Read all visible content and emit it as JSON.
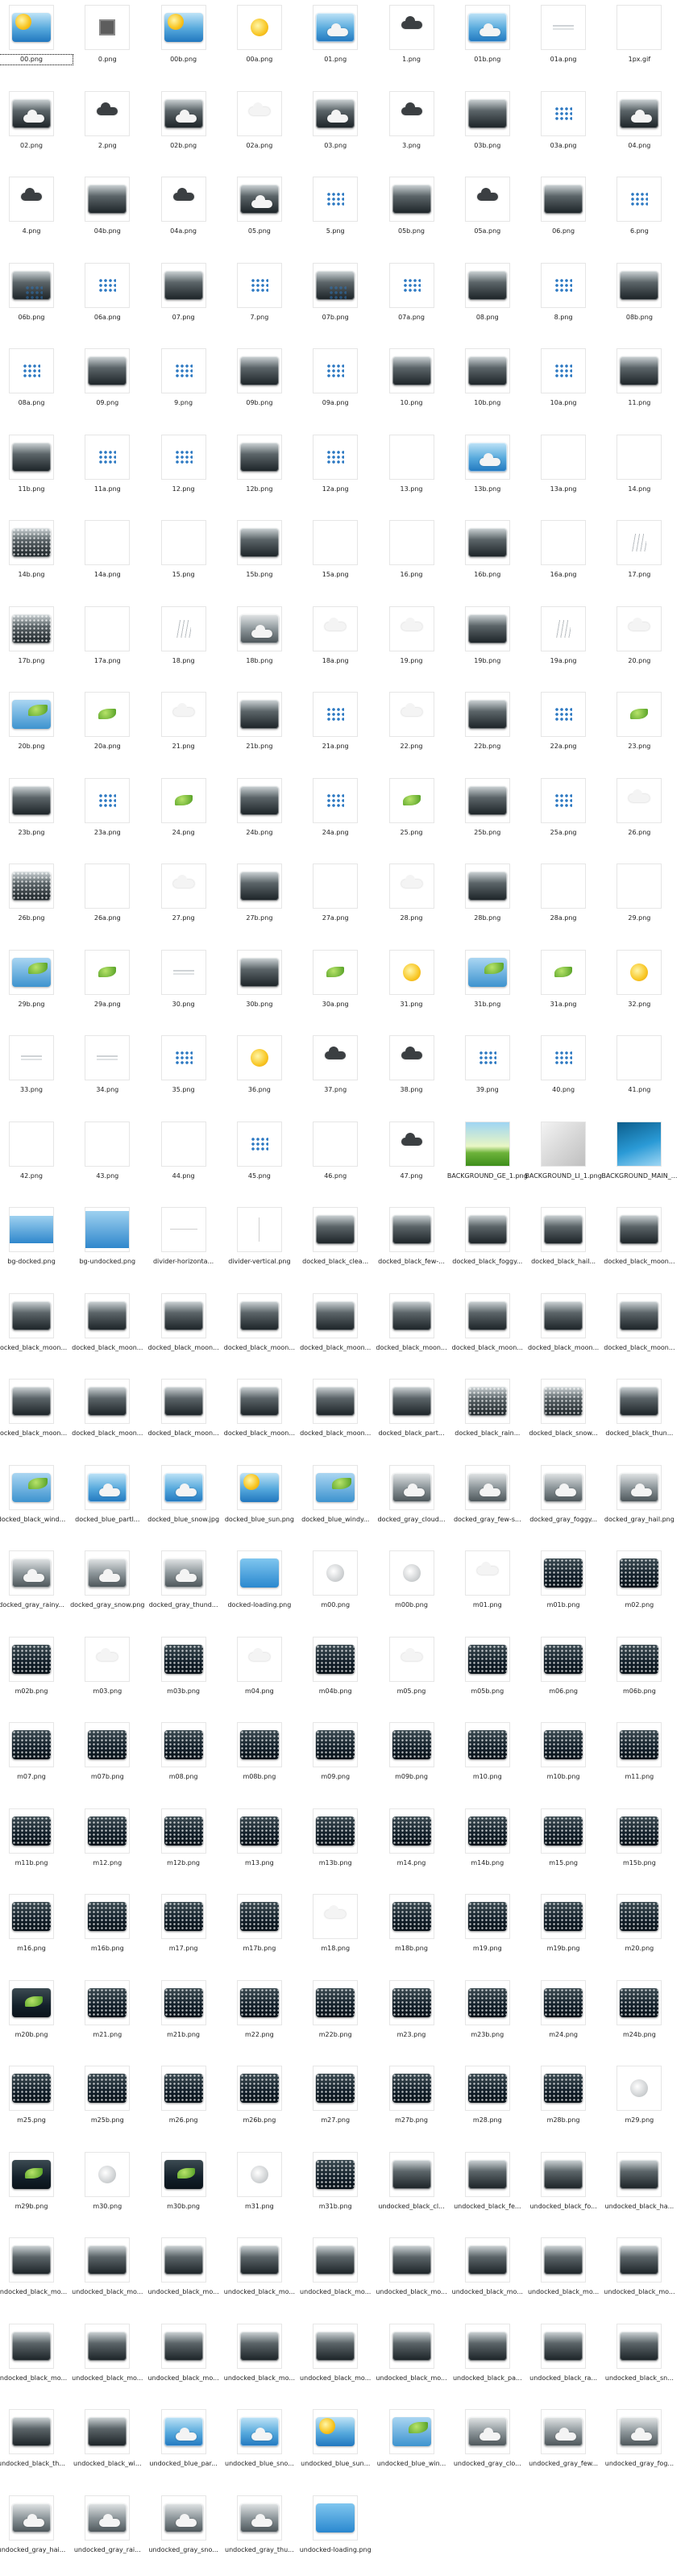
{
  "files": [
    "00.png",
    "0.png",
    "00b.png",
    "00a.png",
    "01.png",
    "1.png",
    "01b.png",
    "01a.png",
    "1px.gif",
    "02.png",
    "2.png",
    "02b.png",
    "02a.png",
    "03.png",
    "3.png",
    "03b.png",
    "03a.png",
    "04.png",
    "4.png",
    "04b.png",
    "04a.png",
    "05.png",
    "5.png",
    "05b.png",
    "05a.png",
    "06.png",
    "6.png",
    "06b.png",
    "06a.png",
    "07.png",
    "7.png",
    "07b.png",
    "07a.png",
    "08.png",
    "8.png",
    "08b.png",
    "08a.png",
    "09.png",
    "9.png",
    "09b.png",
    "09a.png",
    "10.png",
    "10b.png",
    "10a.png",
    "11.png",
    "11b.png",
    "11a.png",
    "12.png",
    "12b.png",
    "12a.png",
    "13.png",
    "13b.png",
    "13a.png",
    "14.png",
    "14b.png",
    "14a.png",
    "15.png",
    "15b.png",
    "15a.png",
    "16.png",
    "16b.png",
    "16a.png",
    "17.png",
    "17b.png",
    "17a.png",
    "18.png",
    "18b.png",
    "18a.png",
    "19.png",
    "19b.png",
    "19a.png",
    "20.png",
    "20b.png",
    "20a.png",
    "21.png",
    "21b.png",
    "21a.png",
    "22.png",
    "22b.png",
    "22a.png",
    "23.png",
    "23b.png",
    "23a.png",
    "24.png",
    "24b.png",
    "24a.png",
    "25.png",
    "25b.png",
    "25a.png",
    "26.png",
    "26b.png",
    "26a.png",
    "27.png",
    "27b.png",
    "27a.png",
    "28.png",
    "28b.png",
    "28a.png",
    "29.png",
    "29b.png",
    "29a.png",
    "30.png",
    "30b.png",
    "30a.png",
    "31.png",
    "31b.png",
    "31a.png",
    "32.png",
    "33.png",
    "34.png",
    "35.png",
    "36.png",
    "37.png",
    "38.png",
    "39.png",
    "40.png",
    "41.png",
    "42.png",
    "43.png",
    "44.png",
    "45.png",
    "46.png",
    "47.png",
    "BACKGROUND_GE_1.png",
    "BACKGROUND_LI_1.png",
    "BACKGROUND_MAIN_...",
    "bg-docked.png",
    "bg-undocked.png",
    "divider-horizonta...",
    "divider-vertical.png",
    "docked_black_clea...",
    "docked_black_few-...",
    "docked_black_foggy...",
    "docked_black_hail...",
    "docked_black_moon...",
    "docked_black_moon...",
    "docked_black_moon...",
    "docked_black_moon...",
    "docked_black_moon...",
    "docked_black_moon...",
    "docked_black_moon...",
    "docked_black_moon...",
    "docked_black_moon...",
    "docked_black_moon...",
    "docked_black_moon...",
    "docked_black_moon...",
    "docked_black_moon...",
    "docked_black_moon...",
    "docked_black_moon...",
    "docked_black_part...",
    "docked_black_rain...",
    "docked_black_snow...",
    "docked_black_thun...",
    "docked_black_wind...",
    "docked_blue_partl...",
    "docked_blue_snow.jpg",
    "docked_blue_sun.png",
    "docked_blue_windy...",
    "docked_gray_cloud...",
    "docked_gray_few-s...",
    "docked_gray_foggy...",
    "docked_gray_hail.png",
    "docked_gray_rainy...",
    "docked_gray_snow.png",
    "docked_gray_thund...",
    "docked-loading.png",
    "m00.png",
    "m00b.png",
    "m01.png",
    "m01b.png",
    "m02.png",
    "m02b.png",
    "m03.png",
    "m03b.png",
    "m04.png",
    "m04b.png",
    "m05.png",
    "m05b.png",
    "m06.png",
    "m06b.png",
    "m07.png",
    "m07b.png",
    "m08.png",
    "m08b.png",
    "m09.png",
    "m09b.png",
    "m10.png",
    "m10b.png",
    "m11.png",
    "m11b.png",
    "m12.png",
    "m12b.png",
    "m13.png",
    "m13b.png",
    "m14.png",
    "m14b.png",
    "m15.png",
    "m15b.png",
    "m16.png",
    "m16b.png",
    "m17.png",
    "m17b.png",
    "m18.png",
    "m18b.png",
    "m19.png",
    "m19b.png",
    "m20.png",
    "m20b.png",
    "m21.png",
    "m21b.png",
    "m22.png",
    "m22b.png",
    "m23.png",
    "m23b.png",
    "m24.png",
    "m24b.png",
    "m25.png",
    "m25b.png",
    "m26.png",
    "m26b.png",
    "m27.png",
    "m27b.png",
    "m28.png",
    "m28b.png",
    "m29.png",
    "m29b.png",
    "m30.png",
    "m30b.png",
    "m31.png",
    "m31b.png",
    "undocked_black_cl...",
    "undocked_black_fe...",
    "undocked_black_fo...",
    "undocked_black_ha...",
    "undocked_black_mo...",
    "undocked_black_mo...",
    "undocked_black_mo...",
    "undocked_black_mo...",
    "undocked_black_mo...",
    "undocked_black_mo...",
    "undocked_black_mo...",
    "undocked_black_mo...",
    "undocked_black_mo...",
    "undocked_black_mo...",
    "undocked_black_mo...",
    "undocked_black_mo...",
    "undocked_black_mo...",
    "undocked_black_mo...",
    "undocked_black_mo...",
    "undocked_black_pa...",
    "undocked_black_ra...",
    "undocked_black_sn...",
    "undocked_black_th...",
    "undocked_black_wi...",
    "undocked_blue_par...",
    "undocked_blue_sno...",
    "undocked_blue_sun...",
    "undocked_blue_win...",
    "undocked_gray_clo...",
    "undocked_gray_few...",
    "undocked_gray_fog...",
    "undocked_gray_hai...",
    "undocked_gray_rai...",
    "undocked_gray_sno...",
    "undocked_gray_thu...",
    "undocked-loading.png"
  ],
  "icons": [
    "sun-panel",
    "square",
    "sun-panel",
    "sun",
    "blue-cloud",
    "dark-cloud",
    "blue-cloud",
    "streak",
    "blank",
    "black-cloud",
    "dark-cloud",
    "black-cloud",
    "cloud",
    "black-cloud",
    "dark-cloud",
    "black",
    "drops",
    "black-cloud",
    "dark-cloud",
    "black",
    "dark-cloud",
    "black-cloud",
    "drops",
    "black",
    "dark-cloud",
    "black",
    "drops",
    "black-rain",
    "drops",
    "black",
    "drops",
    "black-rain",
    "drops",
    "black",
    "drops",
    "black",
    "drops",
    "black",
    "drops",
    "black",
    "drops",
    "black",
    "black",
    "drops",
    "black",
    "black",
    "drops",
    "drops",
    "black",
    "drops",
    "blank",
    "blue",
    "blank",
    "blank",
    "black-snow",
    "blank",
    "blank",
    "black",
    "blank",
    "blank",
    "black",
    "blank",
    "rainlines",
    "black-snow",
    "blank",
    "rainlines",
    "gray",
    "cloud",
    "cloud",
    "black",
    "rainlines",
    "cloud",
    "leaf-panel",
    "leaf",
    "cloud",
    "black",
    "drops",
    "cloud",
    "black",
    "drops",
    "leaf",
    "black",
    "drops",
    "leaf",
    "black",
    "drops",
    "leaf",
    "black",
    "drops",
    "cloud",
    "black-snow",
    "blank",
    "cloud",
    "black",
    "blank",
    "cloud",
    "black",
    "blank",
    "blank",
    "leaf-panel",
    "leaf",
    "streak",
    "black",
    "leaf",
    "sun",
    "leaf-panel",
    "leaf",
    "sun",
    "streak",
    "streak",
    "drops",
    "sun",
    "dark-cloud",
    "dark-cloud",
    "drops",
    "drops",
    "blank",
    "blank",
    "blank",
    "blank",
    "drops",
    "blank",
    "dark-cloud",
    "bg-green",
    "bg-light",
    "bg-blue",
    "bg-docked",
    "bg-undocked",
    "hline",
    "vline",
    "black",
    "black",
    "black",
    "black",
    "black",
    "black",
    "black",
    "black",
    "black",
    "black",
    "black",
    "black",
    "black",
    "black",
    "black",
    "black",
    "black",
    "black",
    "black",
    "black",
    "black-snow",
    "black-snow",
    "black",
    "leaf-panel",
    "blue",
    "blue",
    "sun-panel",
    "leaf-panel",
    "gray",
    "gray",
    "gray",
    "gray",
    "gray",
    "gray",
    "gray",
    "loading",
    "moon",
    "moon",
    "cloud",
    "dark",
    "dark",
    "dark",
    "cloud",
    "dark",
    "cloud",
    "dark",
    "cloud",
    "dark",
    "dark",
    "dark",
    "dark",
    "dark",
    "dark",
    "dark",
    "dark",
    "dark",
    "dark",
    "dark",
    "dark",
    "dark",
    "dark",
    "dark",
    "dark",
    "dark",
    "dark",
    "dark",
    "dark",
    "dark",
    "dark",
    "dark",
    "dark",
    "dark",
    "cloud",
    "dark",
    "dark",
    "dark",
    "dark",
    "leaf-dark",
    "dark",
    "dark",
    "dark",
    "dark",
    "dark",
    "dark",
    "dark",
    "dark",
    "dark",
    "dark",
    "dark",
    "dark",
    "dark",
    "dark",
    "dark",
    "dark",
    "moon",
    "leaf-dark",
    "moon",
    "leaf-dark",
    "moon",
    "dark",
    "black",
    "black",
    "black",
    "black",
    "black",
    "black",
    "black",
    "black",
    "black",
    "black",
    "black",
    "black",
    "black",
    "black",
    "black",
    "black",
    "black",
    "black",
    "black",
    "black",
    "black",
    "black",
    "black",
    "black",
    "blue",
    "blue",
    "sun-panel",
    "leaf-panel",
    "gray",
    "gray",
    "gray",
    "gray",
    "gray",
    "gray",
    "gray",
    "loading"
  ],
  "selected_index": 0
}
